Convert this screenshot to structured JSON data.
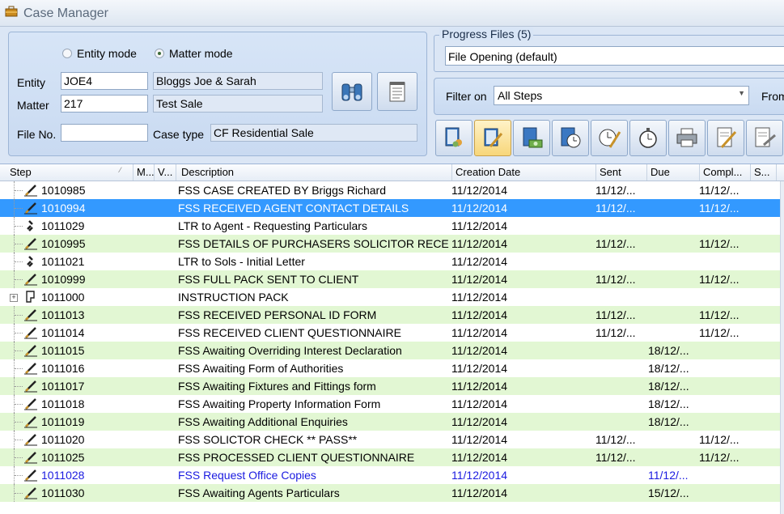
{
  "window": {
    "title": "Case Manager"
  },
  "mode": {
    "entity_label": "Entity mode",
    "matter_label": "Matter mode",
    "selected": "matter"
  },
  "form": {
    "entity_label": "Entity",
    "entity_value": "JOE4",
    "entity_name": "Bloggs Joe & Sarah",
    "matter_label": "Matter",
    "matter_value": "217",
    "matter_name": "Test Sale",
    "file_no_label": "File No.",
    "file_no_value": "",
    "case_type_label": "Case type",
    "case_type_value": "CF Residential Sale"
  },
  "progress": {
    "group_label": "Progress Files (5)",
    "selected": "File Opening (default)"
  },
  "filter": {
    "label": "Filter on",
    "selected": "All Steps",
    "from_label": "From"
  },
  "toolbar": {
    "buttons": [
      {
        "icon": "contacts-book-icon"
      },
      {
        "icon": "notepad-edit-icon",
        "active": true
      },
      {
        "icon": "document-money-icon"
      },
      {
        "icon": "document-clock-icon"
      },
      {
        "icon": "clock-edit-icon"
      },
      {
        "icon": "stopwatch-icon"
      },
      {
        "icon": "printer-icon"
      },
      {
        "icon": "document-sign-icon"
      },
      {
        "icon": "document-write-icon"
      }
    ]
  },
  "grid": {
    "columns": [
      "Step",
      "M...",
      "V...",
      "Description",
      "Creation Date",
      "Sent",
      "Due",
      "Compl...",
      "S..."
    ],
    "rows": [
      {
        "step": "1010985",
        "desc": "FSS CASE CREATED BY Briggs Richard",
        "date": "11/12/2014",
        "sent": "11/12/...",
        "due": "",
        "comp": "11/12/...",
        "icon": "pencil-icon",
        "style": "white"
      },
      {
        "step": "1010994",
        "desc": "FSS RECEIVED AGENT CONTACT DETAILS",
        "date": "11/12/2014",
        "sent": "11/12/...",
        "due": "",
        "comp": "11/12/...",
        "icon": "pencil-icon",
        "style": "selected"
      },
      {
        "step": "1011029",
        "desc": "LTR to Agent - Requesting Particulars",
        "date": "11/12/2014",
        "sent": "",
        "due": "",
        "comp": "",
        "icon": "letter-icon",
        "style": "white"
      },
      {
        "step": "1010995",
        "desc": "FSS DETAILS OF PURCHASERS SOLICITOR RECEI...",
        "date": "11/12/2014",
        "sent": "11/12/...",
        "due": "",
        "comp": "11/12/...",
        "icon": "pencil-icon",
        "style": "green"
      },
      {
        "step": "1011021",
        "desc": "LTR to Sols - Initial Letter",
        "date": "11/12/2014",
        "sent": "",
        "due": "",
        "comp": "",
        "icon": "letter-icon",
        "style": "white"
      },
      {
        "step": "1010999",
        "desc": "FSS FULL PACK SENT TO CLIENT",
        "date": "11/12/2014",
        "sent": "11/12/...",
        "due": "",
        "comp": "11/12/...",
        "icon": "pencil-icon",
        "style": "green"
      },
      {
        "step": "1011000",
        "desc": "INSTRUCTION PACK",
        "date": "11/12/2014",
        "sent": "",
        "due": "",
        "comp": "",
        "icon": "pack-icon",
        "style": "white",
        "expandable": true
      },
      {
        "step": "1011013",
        "desc": "FSS RECEIVED PERSONAL ID FORM",
        "date": "11/12/2014",
        "sent": "11/12/...",
        "due": "",
        "comp": "11/12/...",
        "icon": "pencil-icon",
        "style": "green"
      },
      {
        "step": "1011014",
        "desc": "FSS RECEIVED CLIENT QUESTIONNAIRE",
        "date": "11/12/2014",
        "sent": "11/12/...",
        "due": "",
        "comp": "11/12/...",
        "icon": "pencil-icon",
        "style": "white"
      },
      {
        "step": "1011015",
        "desc": "FSS Awaiting Overriding Interest Declaration",
        "date": "11/12/2014",
        "sent": "",
        "due": "18/12/...",
        "comp": "",
        "icon": "pencil-icon",
        "style": "green"
      },
      {
        "step": "1011016",
        "desc": "FSS Awaiting Form of Authorities",
        "date": "11/12/2014",
        "sent": "",
        "due": "18/12/...",
        "comp": "",
        "icon": "pencil-icon",
        "style": "white"
      },
      {
        "step": "1011017",
        "desc": "FSS Awaiting Fixtures and Fittings form",
        "date": "11/12/2014",
        "sent": "",
        "due": "18/12/...",
        "comp": "",
        "icon": "pencil-icon",
        "style": "green"
      },
      {
        "step": "1011018",
        "desc": "FSS Awaiting Property Information Form",
        "date": "11/12/2014",
        "sent": "",
        "due": "18/12/...",
        "comp": "",
        "icon": "pencil-icon",
        "style": "white"
      },
      {
        "step": "1011019",
        "desc": "FSS Awaiting Additional Enquiries",
        "date": "11/12/2014",
        "sent": "",
        "due": "18/12/...",
        "comp": "",
        "icon": "pencil-icon",
        "style": "green"
      },
      {
        "step": "1011020",
        "desc": "FSS SOLICTOR CHECK ** PASS**",
        "date": "11/12/2014",
        "sent": "11/12/...",
        "due": "",
        "comp": "11/12/...",
        "icon": "pencil-icon",
        "style": "white"
      },
      {
        "step": "1011025",
        "desc": "FSS PROCESSED CLIENT QUESTIONNAIRE",
        "date": "11/12/2014",
        "sent": "11/12/...",
        "due": "",
        "comp": "11/12/...",
        "icon": "pencil-icon",
        "style": "green"
      },
      {
        "step": "1011028",
        "desc": "FSS Request Office Copies",
        "date": "11/12/2014",
        "sent": "",
        "due": "11/12/...",
        "comp": "",
        "icon": "pencil-icon",
        "style": "blue"
      },
      {
        "step": "1011030",
        "desc": "FSS Awaiting Agents Particulars",
        "date": "11/12/2014",
        "sent": "",
        "due": "15/12/...",
        "comp": "",
        "icon": "pencil-icon",
        "style": "green"
      }
    ]
  }
}
